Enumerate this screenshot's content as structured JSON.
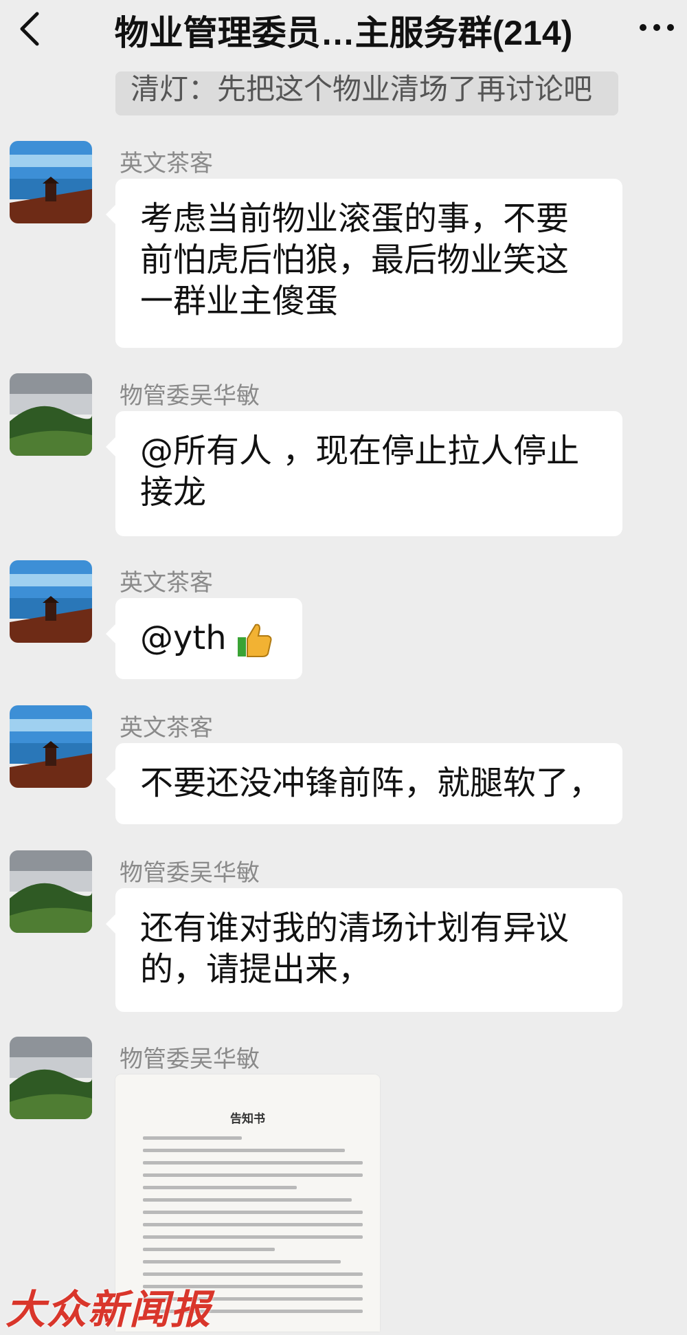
{
  "header": {
    "title": "物业管理委员…主服务群(214)",
    "back_icon": "chevron-left-icon",
    "more_icon": "more-dots-icon"
  },
  "system_message": "清灯：先把这个物业清场了再讨论吧",
  "messages": [
    {
      "sender": "英文茶客",
      "text": "考虑当前物业滚蛋的事，不要前怕虎后怕狼，最后物业笑这一群业主傻蛋",
      "avatar": "landscape-pagoda"
    },
    {
      "sender": "物管委吴华敏",
      "text": "@所有人 ，现在停止拉人停止接龙",
      "avatar": "landscape-tea-hills"
    },
    {
      "sender": "英文茶客",
      "text": "@yth",
      "emoji": "thumbs-up-icon",
      "avatar": "landscape-pagoda"
    },
    {
      "sender": "英文茶客",
      "text": "不要还没冲锋前阵，就腿软了，",
      "avatar": "landscape-pagoda"
    },
    {
      "sender": "物管委吴华敏",
      "text": "还有谁对我的清场计划有异议的，请提出来，",
      "avatar": "landscape-tea-hills"
    },
    {
      "sender": "物管委吴华敏",
      "image": "notice-document",
      "doc_title": "告知书",
      "avatar": "landscape-tea-hills"
    }
  ],
  "watermark": "大众新闻报",
  "colors": {
    "background": "#ededed",
    "bubble": "#ffffff",
    "sender": "#8a8a8a",
    "watermark": "#d9362b"
  }
}
